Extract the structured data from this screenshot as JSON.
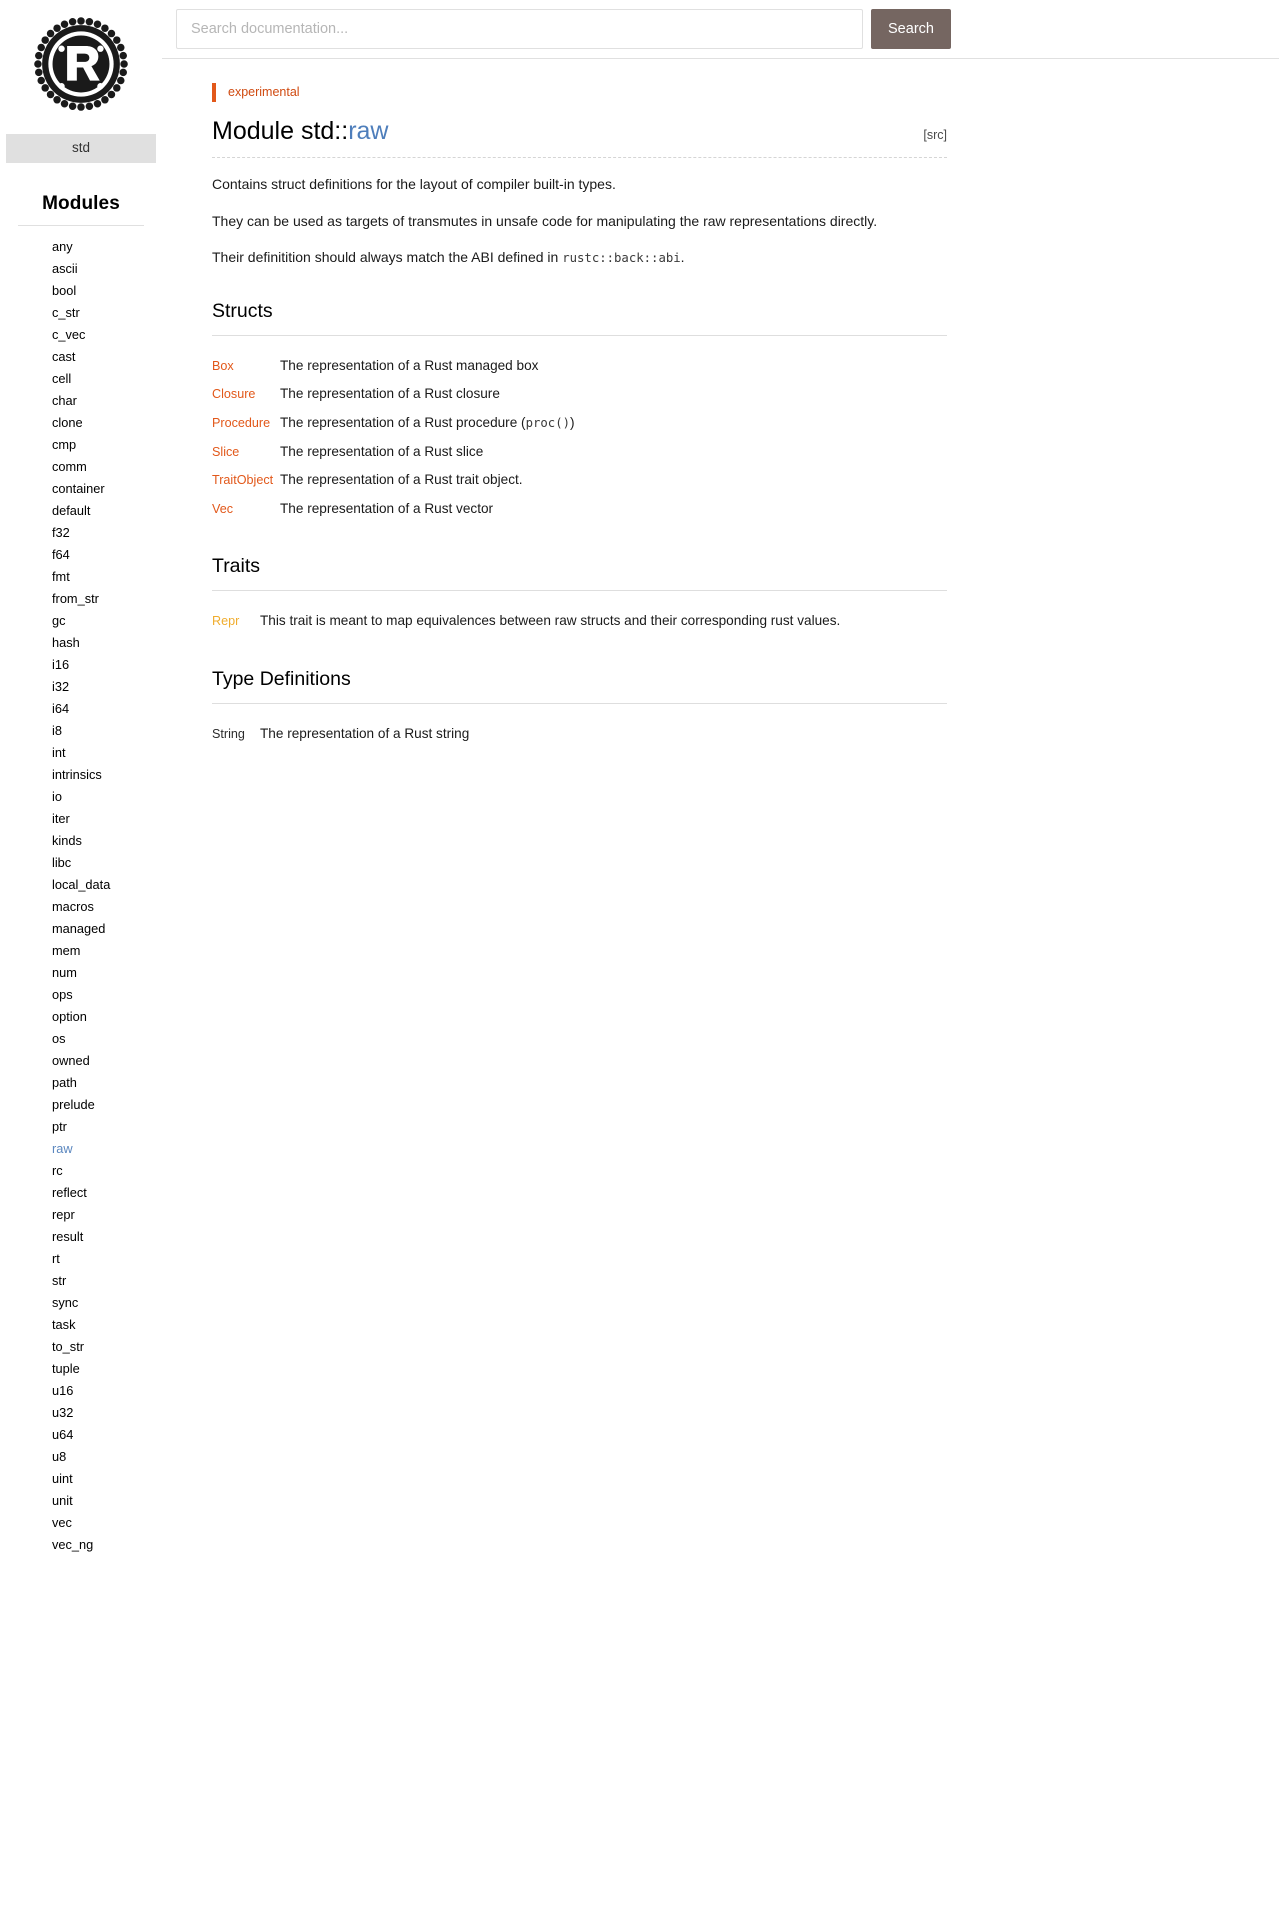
{
  "search": {
    "placeholder": "Search documentation...",
    "value": "",
    "button_label": "Search"
  },
  "sidebar": {
    "logo_alt": "rust-logo",
    "crate_label": "std",
    "section_title": "Modules",
    "current_module": "raw",
    "modules": [
      "any",
      "ascii",
      "bool",
      "c_str",
      "c_vec",
      "cast",
      "cell",
      "char",
      "clone",
      "cmp",
      "comm",
      "container",
      "default",
      "f32",
      "f64",
      "fmt",
      "from_str",
      "gc",
      "hash",
      "i16",
      "i32",
      "i64",
      "i8",
      "int",
      "intrinsics",
      "io",
      "iter",
      "kinds",
      "libc",
      "local_data",
      "macros",
      "managed",
      "mem",
      "num",
      "ops",
      "option",
      "os",
      "owned",
      "path",
      "prelude",
      "ptr",
      "raw",
      "rc",
      "reflect",
      "repr",
      "result",
      "rt",
      "str",
      "sync",
      "task",
      "to_str",
      "tuple",
      "u16",
      "u32",
      "u64",
      "u8",
      "uint",
      "unit",
      "vec",
      "vec_ng"
    ]
  },
  "main": {
    "stability": "experimental",
    "title_prefix": "Module std::",
    "title_module": "raw",
    "src_link": "[src]",
    "paragraphs": [
      "Contains struct definitions for the layout of compiler built-in types.",
      "They can be used as targets of transmutes in unsafe code for manipulating the raw representations directly.",
      "Their definitition should always match the ABI defined in "
    ],
    "abi_code": "rustc::back::abi",
    "abi_suffix": ".",
    "sections": {
      "structs": {
        "heading": "Structs",
        "items": [
          {
            "name": "Box",
            "desc": "The representation of a Rust managed box",
            "code": "",
            "desc_tail": ""
          },
          {
            "name": "Closure",
            "desc": "The representation of a Rust closure",
            "code": "",
            "desc_tail": ""
          },
          {
            "name": "Procedure",
            "desc": "The representation of a Rust procedure (",
            "code": "proc()",
            "desc_tail": ")"
          },
          {
            "name": "Slice",
            "desc": "The representation of a Rust slice",
            "code": "",
            "desc_tail": ""
          },
          {
            "name": "TraitObject",
            "desc": "The representation of a Rust trait object.",
            "code": "",
            "desc_tail": ""
          },
          {
            "name": "Vec",
            "desc": "The representation of a Rust vector",
            "code": "",
            "desc_tail": ""
          }
        ]
      },
      "traits": {
        "heading": "Traits",
        "items": [
          {
            "name": "Repr",
            "desc": "This trait is meant to map equivalences between raw structs and their corresponding rust values."
          }
        ]
      },
      "typedefs": {
        "heading": "Type Definitions",
        "items": [
          {
            "name": "String",
            "desc": "The representation of a Rust string"
          }
        ]
      }
    }
  },
  "colors": {
    "struct_link": "#e2581a",
    "trait_link": "#f0ad2e",
    "module_link": "#4e7ebb",
    "stability": "#d04a10",
    "search_button_bg": "#756661",
    "crate_box_bg": "#e0e0e0"
  }
}
